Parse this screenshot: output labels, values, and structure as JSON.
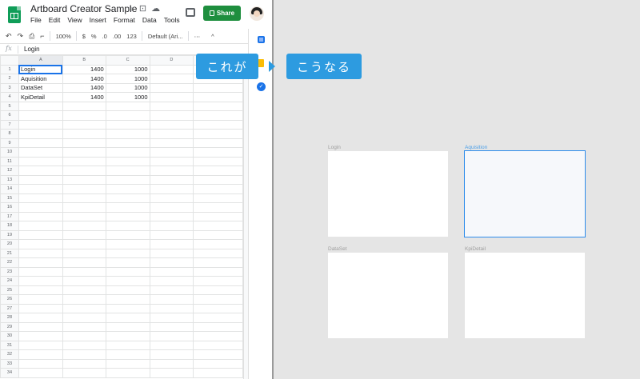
{
  "sheets": {
    "doc_title": "Artboard Creator Sample",
    "title_icons": [
      "star-icon",
      "move-to-folder-icon",
      "cloud-status-icon"
    ],
    "menu": [
      "File",
      "Edit",
      "View",
      "Insert",
      "Format",
      "Data",
      "Tools"
    ],
    "share_label": "Share",
    "toolbar": {
      "zoom": "100%",
      "currency": "$",
      "percent": "%",
      "decrease_decimal": ".0",
      "increase_decimal": ".00",
      "more_formats": "123",
      "font": "Default (Ari...",
      "more": "⋯",
      "collapse": "^"
    },
    "formula_bar": {
      "fx": "fx",
      "value": "Login"
    },
    "columns": [
      "A",
      "B",
      "C",
      "D"
    ],
    "rows": [
      {
        "n": "1",
        "a": "Login",
        "b": "1400",
        "c": "1000"
      },
      {
        "n": "2",
        "a": "Aquisition",
        "b": "1400",
        "c": "1000"
      },
      {
        "n": "3",
        "a": "DataSet",
        "b": "1400",
        "c": "1000"
      },
      {
        "n": "4",
        "a": "KpiDetail",
        "b": "1400",
        "c": "1000"
      }
    ],
    "empty_row_count_label": "5-34",
    "colors": {
      "share": "#1e8e3e",
      "selection": "#1a73e8"
    }
  },
  "callouts": {
    "left": "これが",
    "right": "こうなる",
    "color": "#2d9be0"
  },
  "canvas": {
    "artboards": [
      {
        "label": "Login",
        "active": false
      },
      {
        "label": "Aquisition",
        "active": true
      },
      {
        "label": "DataSet",
        "active": false
      },
      {
        "label": "KpiDetail",
        "active": false
      }
    ],
    "active_color": "#2d8ceb"
  }
}
